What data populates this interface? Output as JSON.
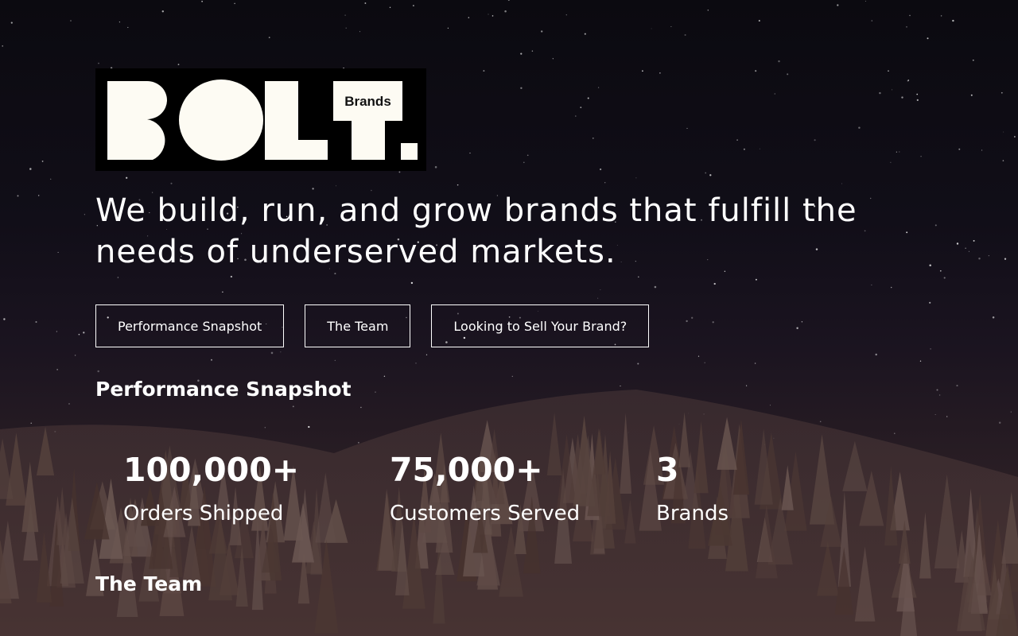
{
  "logo": {
    "wordmark": "BOLT.",
    "badge_text": "Brands"
  },
  "hero": {
    "tagline": "We build, run, and grow brands that fulfill the needs of underserved markets."
  },
  "nav": {
    "buttons": [
      {
        "label": "Performance Snapshot"
      },
      {
        "label": "The Team"
      },
      {
        "label": "Looking to Sell Your Brand?"
      }
    ]
  },
  "performance": {
    "title": "Performance Snapshot",
    "stats": [
      {
        "value": "100,000+",
        "label": "Orders Shipped"
      },
      {
        "value": "75,000+",
        "label": "Customers Served"
      },
      {
        "value": "3",
        "label": "Brands"
      }
    ]
  },
  "team": {
    "title": "The Team"
  },
  "colors": {
    "logo_fill": "#fdfbf3",
    "logo_bg": "#000000",
    "text": "#ffffff"
  }
}
